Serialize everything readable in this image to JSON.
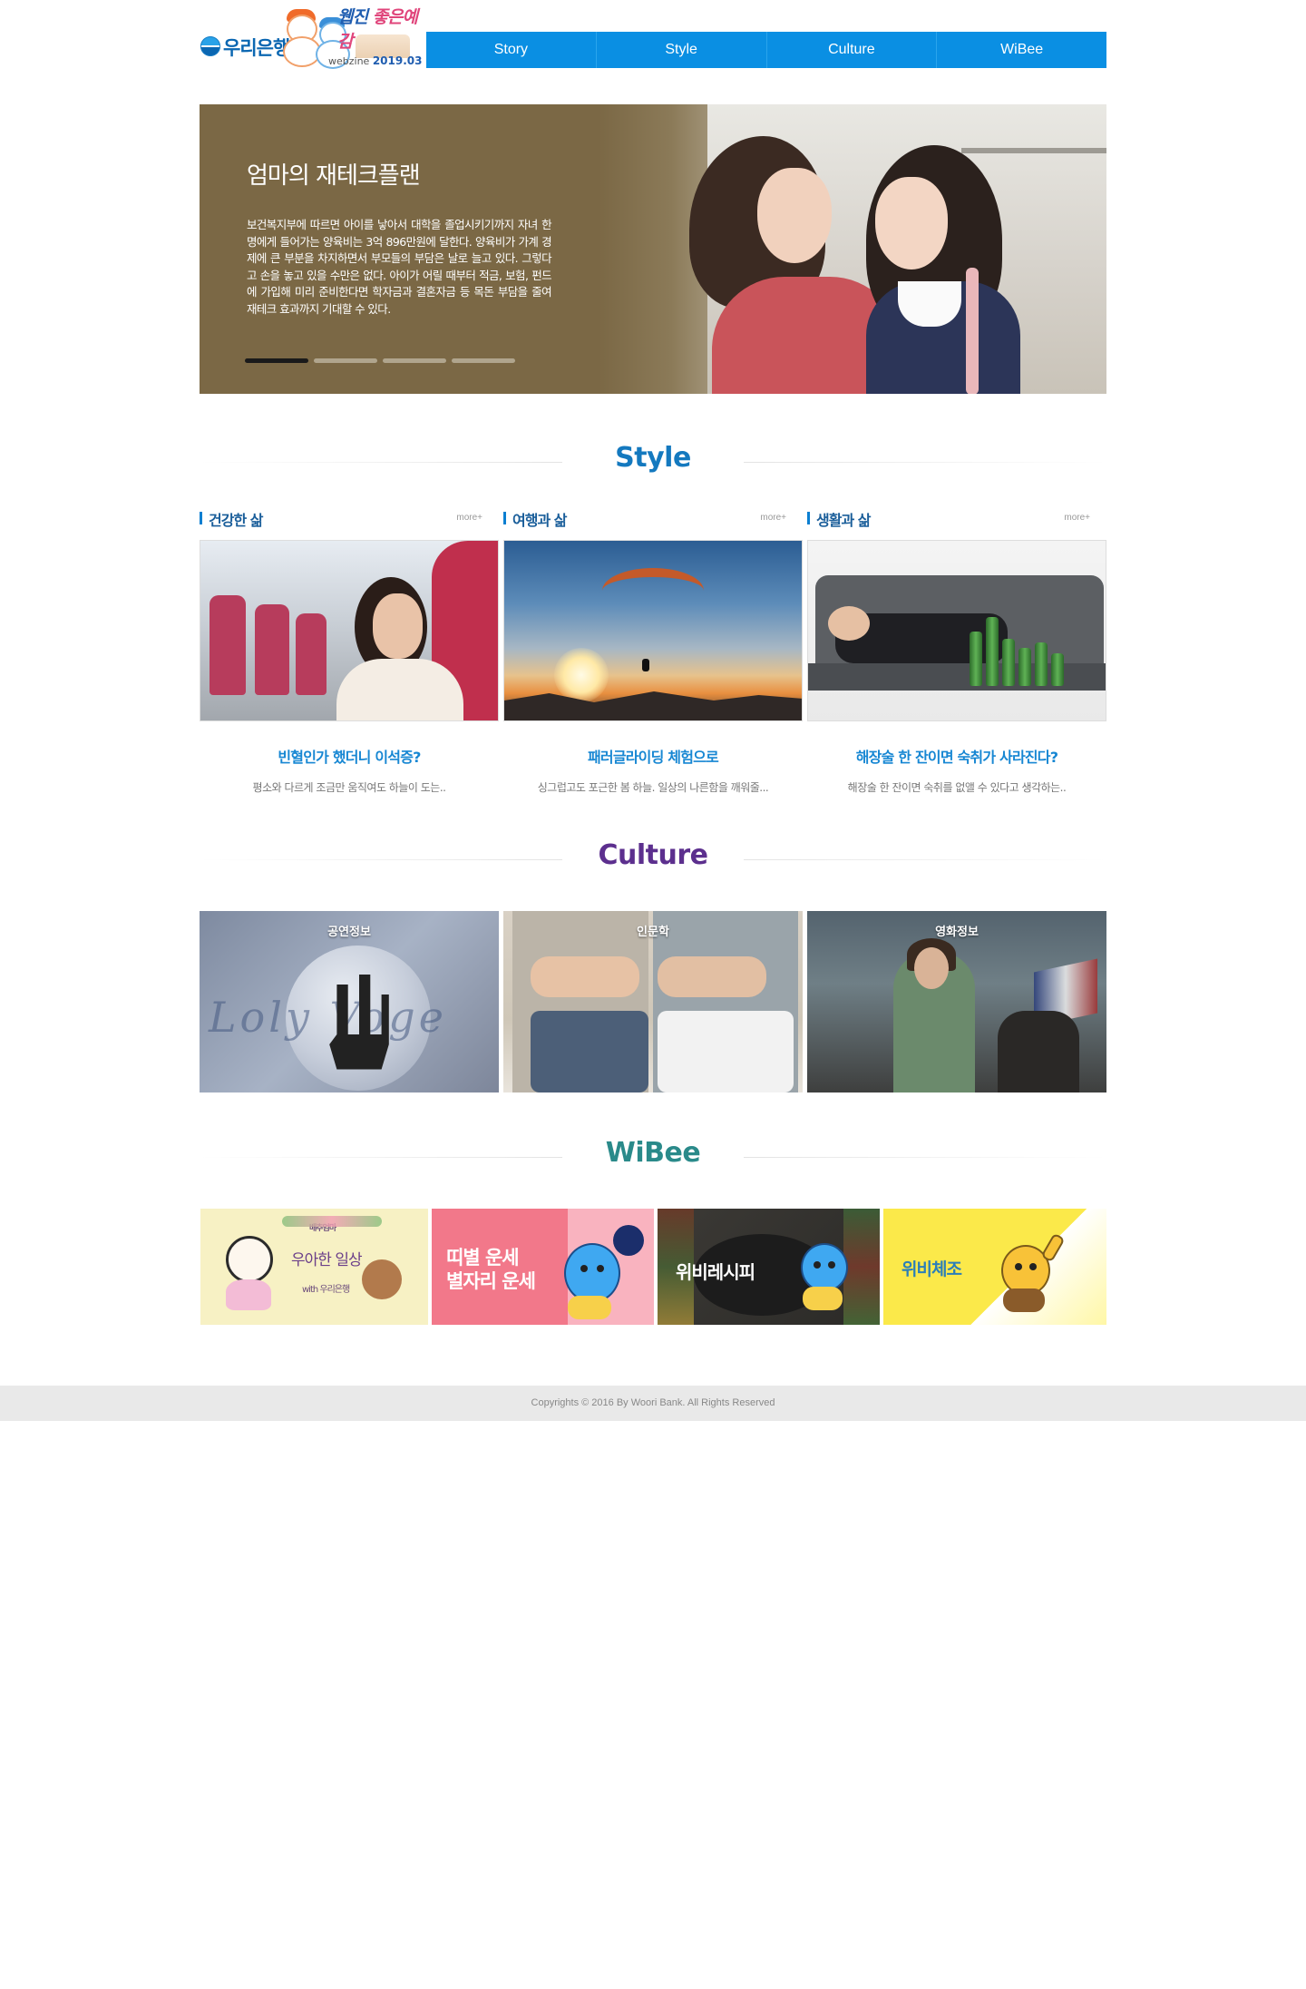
{
  "brand": {
    "bank_name": "우리은행",
    "webzine_title_a": "웹진 ",
    "webzine_title_b": "좋은예감",
    "webzine_word": "webzine",
    "issue": "2019.03"
  },
  "nav": {
    "items": [
      {
        "label": "Story"
      },
      {
        "label": "Style"
      },
      {
        "label": "Culture"
      },
      {
        "label": "WiBee"
      }
    ]
  },
  "hero": {
    "title": "엄마의 재테크플랜",
    "text": "보건복지부에 따르면 아이를 낳아서 대학을 졸업시키기까지 자녀 한명에게 들어가는 양육비는 3억 896만원에 달한다. 양육비가 가계 경제에 큰 부분을 차지하면서 부모들의 부담은 날로 늘고 있다. 그렇다고 손을 놓고 있을 수만은 없다. 아이가 어릴 때부터 적금, 보험, 펀드에 가입해 미리 준비한다면 학자금과 결혼자금 등 목돈 부담을 줄여 재테크 효과까지 기대할 수 있다.",
    "slide_count": 4,
    "active_slide": 1
  },
  "style_section": {
    "title": "Style",
    "title_color": "#1479bf",
    "cards": [
      {
        "category": "건강한 삶",
        "more": "more+",
        "title": "빈혈인가 했더니 이석증?",
        "desc": "평소와 다르게 조금만 움직여도 하늘이 도는.."
      },
      {
        "category": "여행과 삶",
        "more": "more+",
        "title": "패러글라이딩 체험으로",
        "desc": "싱그럽고도 포근한 봄 하늘. 일상의 나른함을 깨워줄..."
      },
      {
        "category": "생활과 삶",
        "more": "more+",
        "title": "해장술 한 잔이면 숙취가 사라진다?",
        "desc": "해장술 한 잔이면 숙취를 없앨 수 있다고 생각하는.."
      }
    ]
  },
  "culture_section": {
    "title": "Culture",
    "title_color": "#5c2f8e",
    "tiles": [
      {
        "label": "공연정보"
      },
      {
        "label": "인문학"
      },
      {
        "label": "영화정보"
      }
    ]
  },
  "wibee_section": {
    "title": "WiBee",
    "title_color": "#2a8a8a",
    "banners": [
      {
        "small": "배추엄마",
        "main": "우아한 일상",
        "sub": "with 우리은행"
      },
      {
        "line1": "띠별 운세",
        "line2": "별자리 운세"
      },
      {
        "main": "위비레시피"
      },
      {
        "main": "위비체조"
      }
    ]
  },
  "footer": {
    "copyright": "Copyrights © 2016 By Woori Bank. All Rights Reserved"
  }
}
